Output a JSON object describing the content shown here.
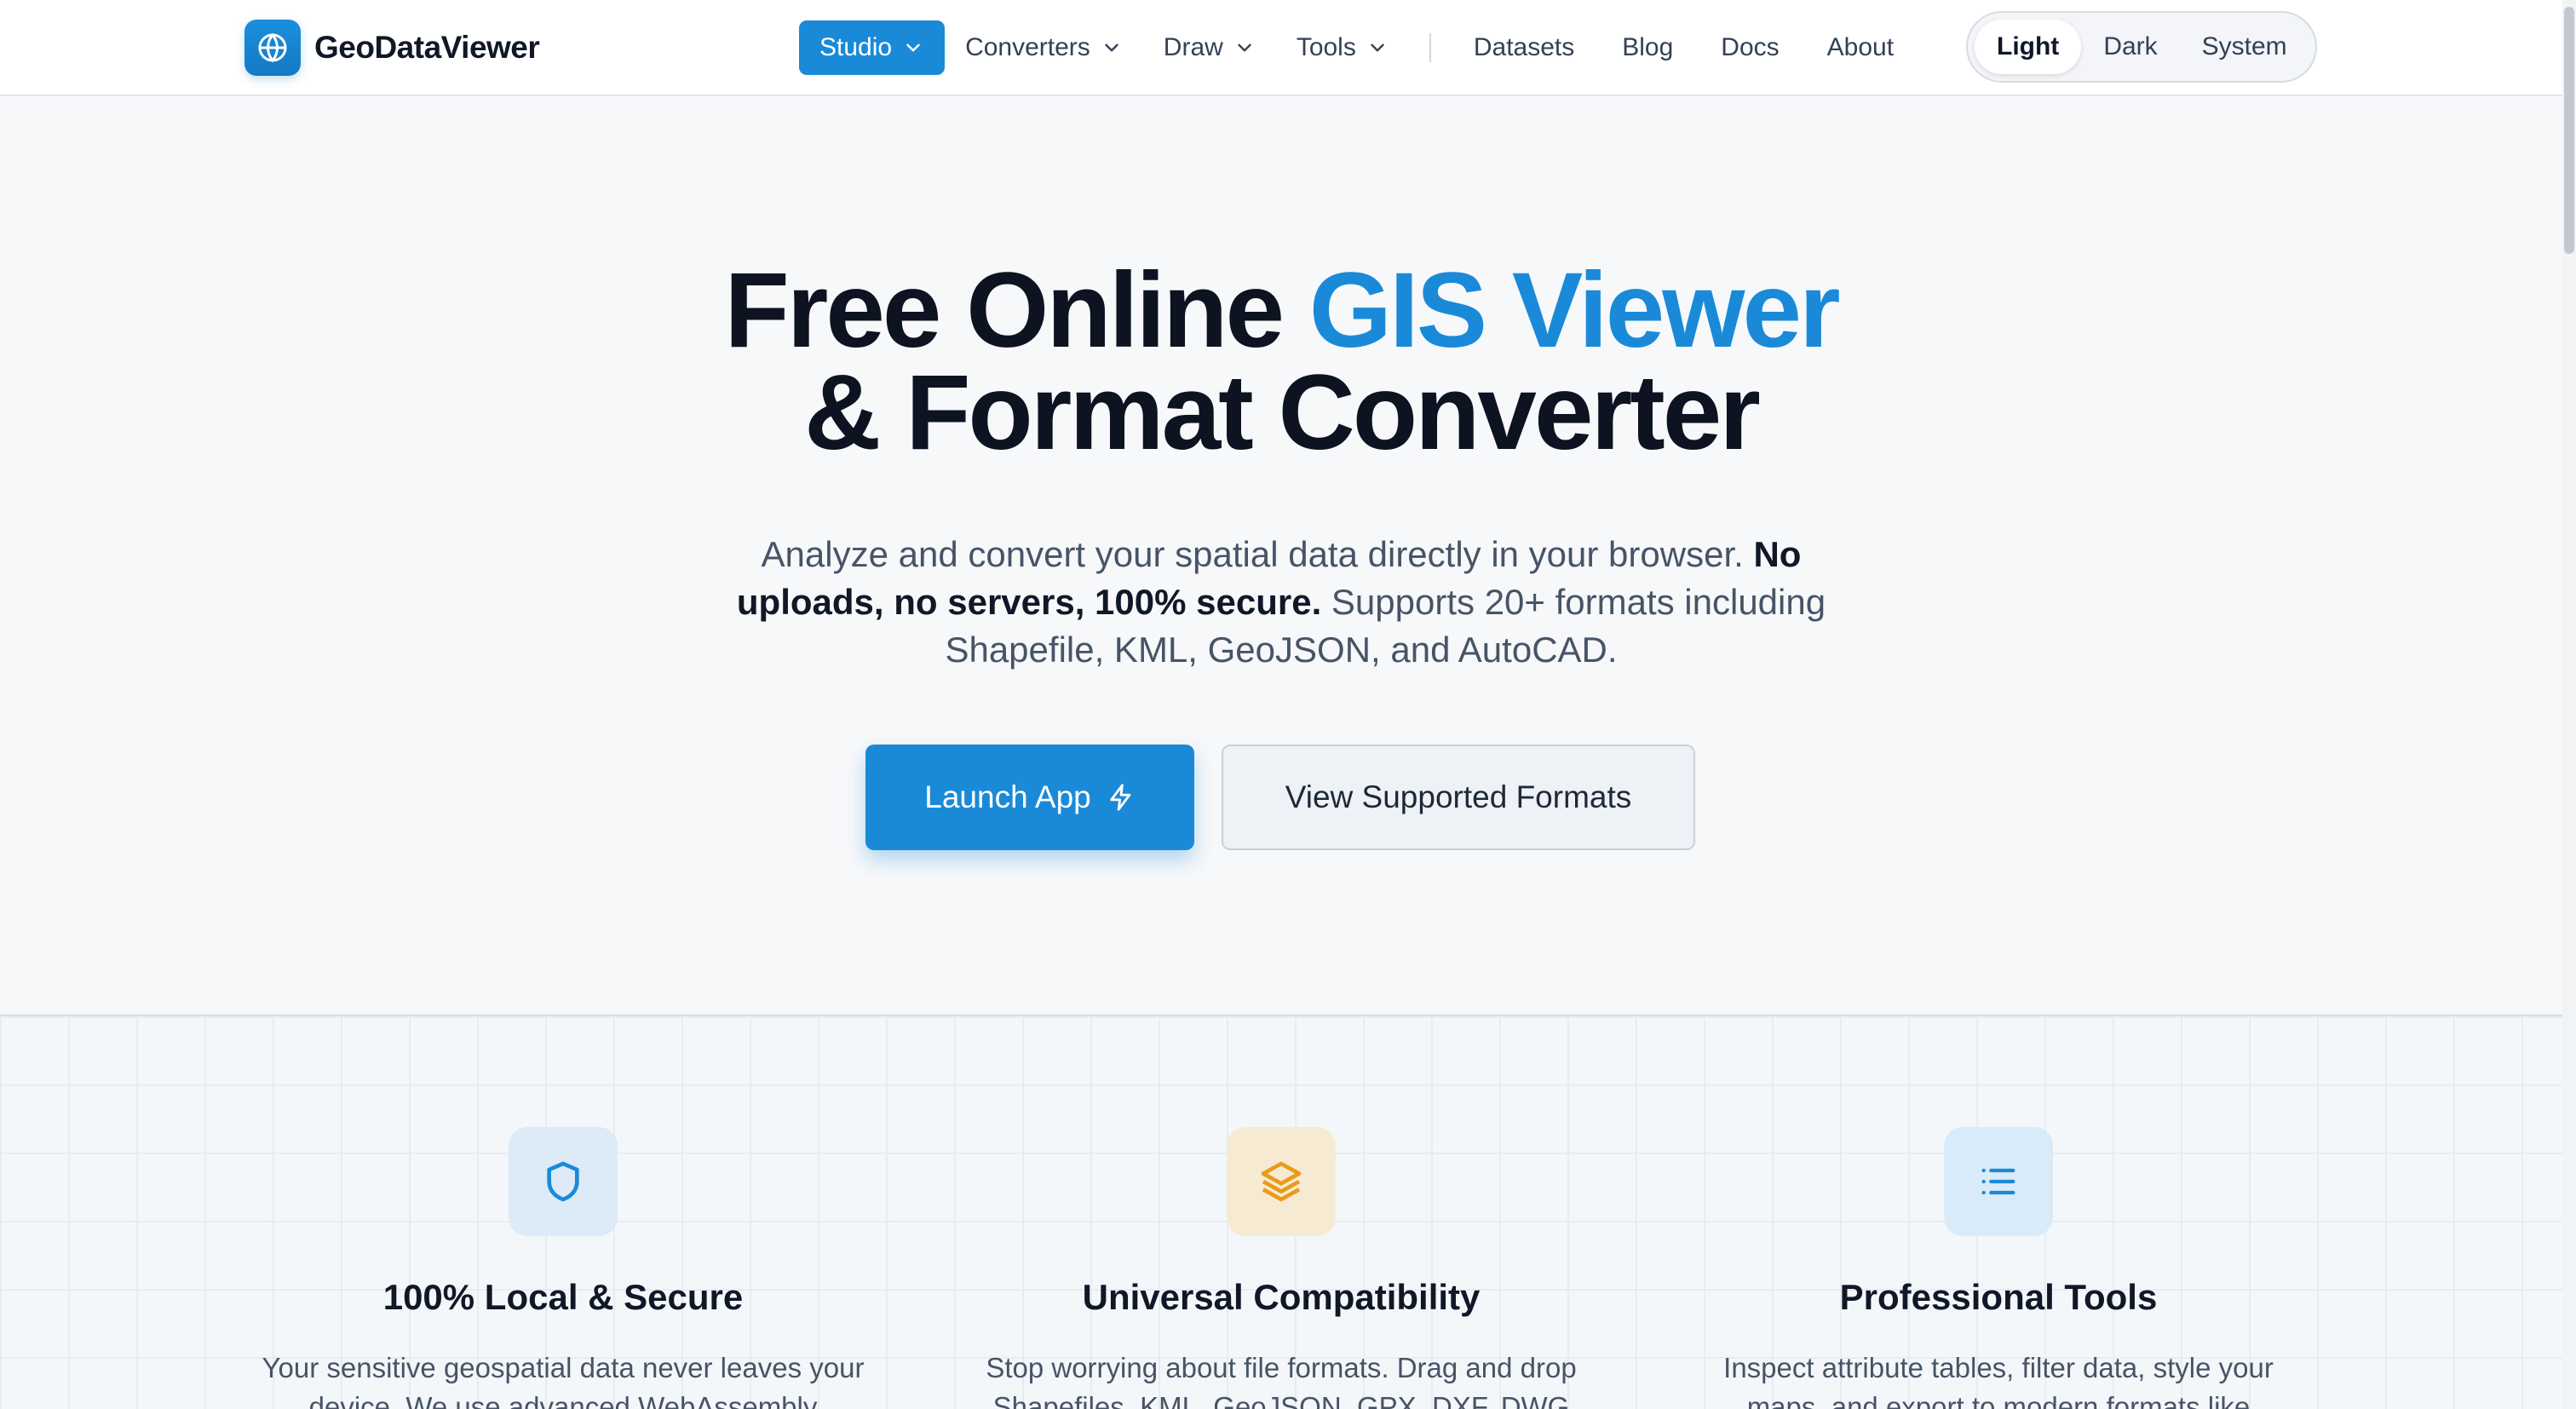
{
  "header": {
    "brand": "GeoDataViewer",
    "nav": [
      {
        "label": "Studio"
      },
      {
        "label": "Converters"
      },
      {
        "label": "Draw"
      },
      {
        "label": "Tools"
      }
    ],
    "links": [
      "Datasets",
      "Blog",
      "Docs",
      "About"
    ],
    "theme": {
      "options": [
        "Light",
        "Dark",
        "System"
      ],
      "selected": "Light"
    }
  },
  "hero": {
    "title_part1": "Free Online ",
    "title_accent": "GIS Viewer",
    "title_line2": "& Format Converter",
    "sub_part1": "Analyze and convert your spatial data directly in your browser. ",
    "sub_bold": "No uploads, no servers, 100% secure.",
    "sub_part2": " Supports 20+ formats including Shapefile, KML, GeoJSON, and AutoCAD.",
    "primary_cta": "Launch App",
    "secondary_cta": "View Supported Formats"
  },
  "features": [
    {
      "icon": "shield-icon",
      "title": "100% Local & Secure",
      "text": "Your sensitive geospatial data never leaves your device. We use advanced WebAssembly"
    },
    {
      "icon": "layers-icon",
      "title": "Universal Compatibility",
      "text": "Stop worrying about file formats. Drag and drop Shapefiles, KML, GeoJSON, GPX, DXF, DWG"
    },
    {
      "icon": "list-icon",
      "title": "Professional Tools",
      "text": "Inspect attribute tables, filter data, style your maps, and export to modern formats like"
    }
  ],
  "colors": {
    "accent": "#1a8ad8",
    "text": "#0d1320",
    "amber": "#e89b1a"
  }
}
